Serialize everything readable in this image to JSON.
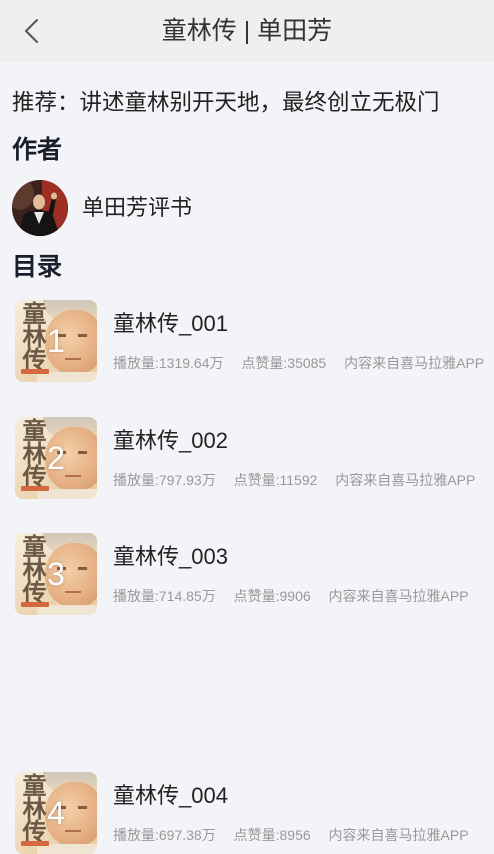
{
  "header": {
    "title": "童林传 | 单田芳",
    "back_icon": "chevron-left-icon"
  },
  "recommendation": "推荐：讲述童林别开天地，最终创立无极门",
  "author": {
    "heading": "作者",
    "name": "单田芳评书"
  },
  "catalog": {
    "heading": "目录",
    "cover_text": "童林传",
    "items": [
      {
        "number": "1",
        "title": "童林传_001",
        "plays": "播放量:1319.64万",
        "likes": "点赞量:35085",
        "source": "内容来自喜马拉雅APP"
      },
      {
        "number": "2",
        "title": "童林传_002",
        "plays": "播放量:797.93万",
        "likes": "点赞量:11592",
        "source": "内容来自喜马拉雅APP"
      },
      {
        "number": "3",
        "title": "童林传_003",
        "plays": "播放量:714.85万",
        "likes": "点赞量:9906",
        "source": "内容来自喜马拉雅APP"
      },
      {
        "number": "4",
        "title": "童林传_004",
        "plays": "播放量:697.38万",
        "likes": "点赞量:8956",
        "source": "内容来自喜马拉雅APP"
      }
    ]
  },
  "colors": {
    "page_background": "#f3f4f8",
    "header_background": "#efeff2",
    "text_primary": "#222222",
    "heading_text": "#1c1d2b",
    "meta_text": "#999999"
  }
}
